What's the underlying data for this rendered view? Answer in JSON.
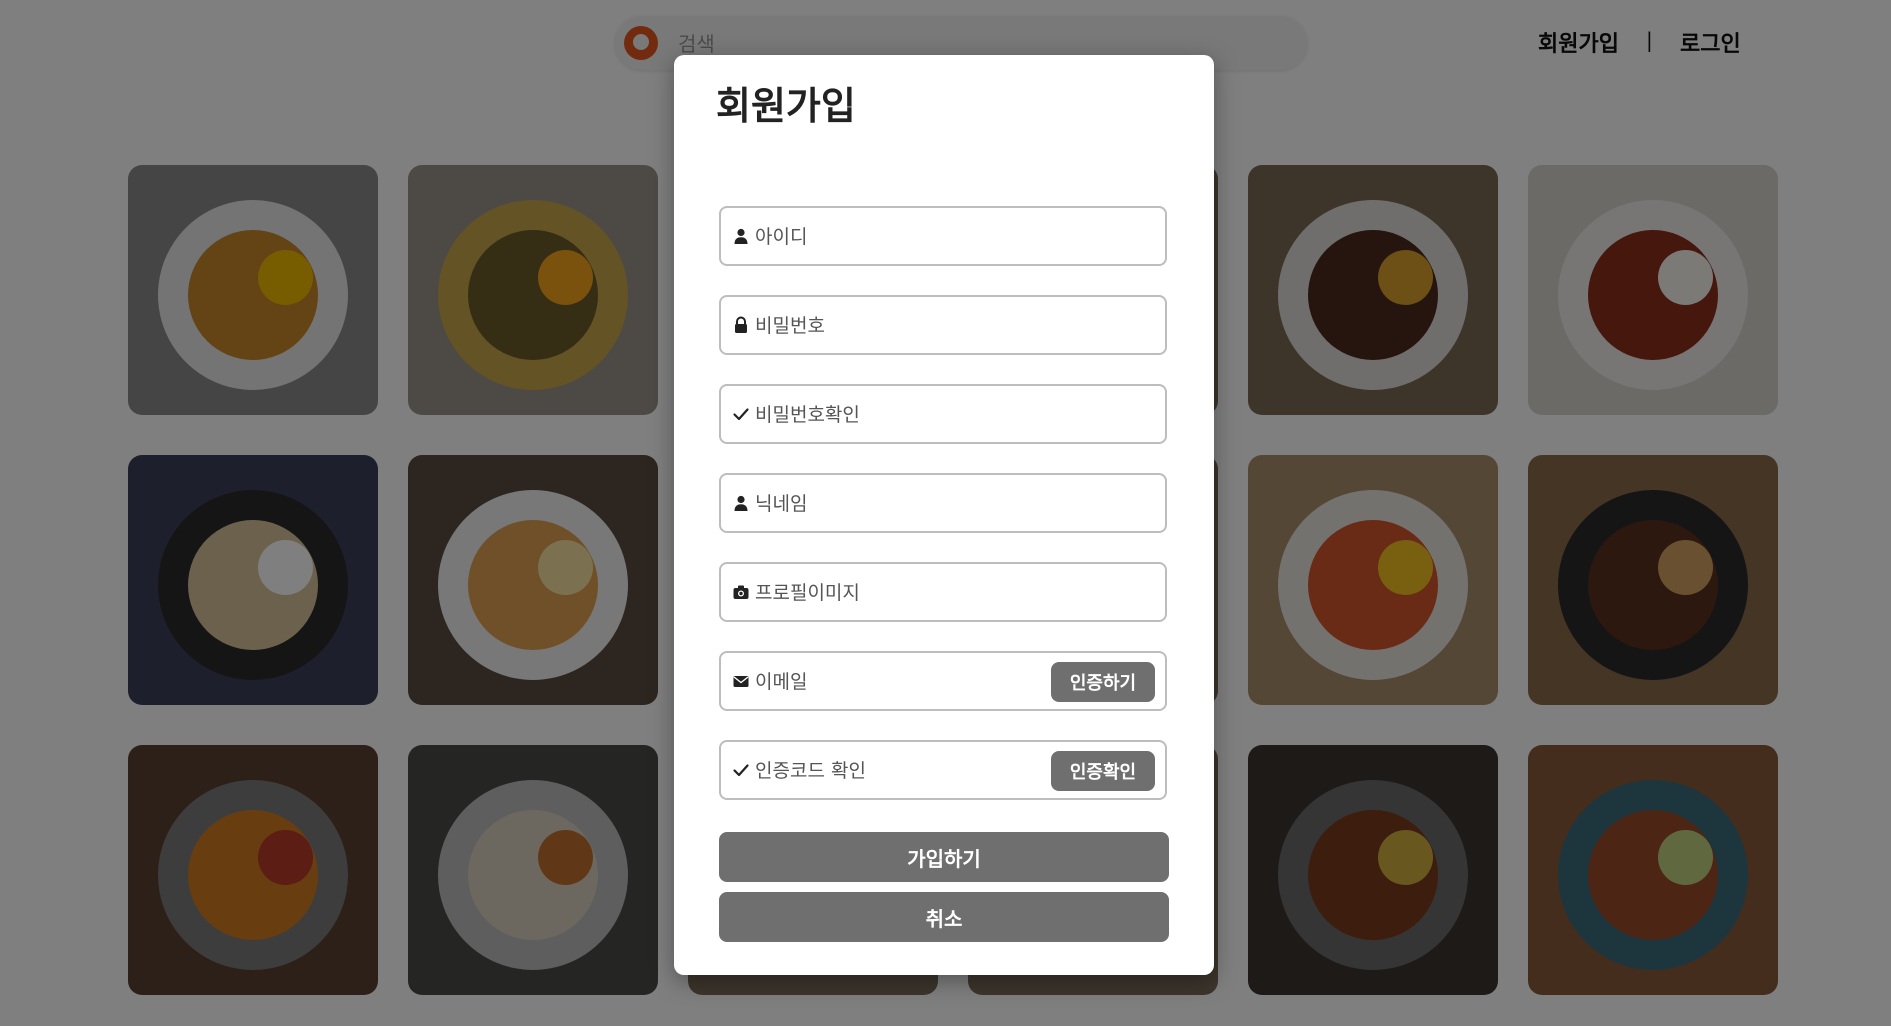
{
  "header": {
    "search_placeholder": "검색",
    "signup_link": "회원가입",
    "separator": "|",
    "login_link": "로그인"
  },
  "gallery": {
    "tiles": [
      {
        "name": "ramen-with-fried-egg",
        "bg": "#8a8a8a",
        "plate": "#e8e8e8",
        "food": "#c8862a",
        "accent": "#f0b800"
      },
      {
        "name": "bibimbap-bowl",
        "bg": "#9a958c",
        "plate": "#c7a64b",
        "food": "#6c5a2a",
        "accent": "#f4a21a"
      },
      {
        "name": "center-tile-1",
        "bg": "#7a6a5a",
        "plate": "#b08060",
        "food": "#6a3a20",
        "accent": "#d09040"
      },
      {
        "name": "center-tile-2",
        "bg": "#7a6a5a",
        "plate": "#b08060",
        "food": "#6a3a20",
        "accent": "#d09040"
      },
      {
        "name": "grilled-steak",
        "bg": "#7d6a55",
        "plate": "#e0ddd8",
        "food": "#4a2a1c",
        "accent": "#d9a02a"
      },
      {
        "name": "ghost-meatballs",
        "bg": "#d8d4cf",
        "plate": "#efece8",
        "food": "#8a2f1a",
        "accent": "#f7f4ee"
      },
      {
        "name": "fishcake-skewers",
        "bg": "#3b4158",
        "plate": "#2b2b2b",
        "food": "#d9c39a",
        "accent": "#ffffff"
      },
      {
        "name": "souffle-pancakes",
        "bg": "#5a4a3f",
        "plate": "#f0f0f0",
        "food": "#e0a050",
        "accent": "#f6e2a0"
      },
      {
        "name": "center-tile-3",
        "bg": "#7a6a5a",
        "plate": "#b08060",
        "food": "#6a3a20",
        "accent": "#d09040"
      },
      {
        "name": "center-tile-4",
        "bg": "#7a6a5a",
        "plate": "#b08060",
        "food": "#6a3a20",
        "accent": "#d09040"
      },
      {
        "name": "tteokbokki-set",
        "bg": "#a88f6d",
        "plate": "#e8e4df",
        "food": "#d2562a",
        "accent": "#f0c020"
      },
      {
        "name": "steak-cubes-skillet",
        "bg": "#8a6a4a",
        "plate": "#2a2a2a",
        "food": "#5a3020",
        "accent": "#d0a060"
      },
      {
        "name": "spicy-noodle-pan",
        "bg": "#5a4030",
        "plate": "#7a7a7a",
        "food": "#d07a20",
        "accent": "#b83a2a"
      },
      {
        "name": "oden-pot",
        "bg": "#4a4a48",
        "plate": "#bcbcbc",
        "food": "#d8d0c0",
        "accent": "#c07030"
      },
      {
        "name": "center-tile-5",
        "bg": "#7a6a5a",
        "plate": "#b08060",
        "food": "#6a3a20",
        "accent": "#d09040"
      },
      {
        "name": "center-tile-6",
        "bg": "#7a6a5a",
        "plate": "#b08060",
        "food": "#6a3a20",
        "accent": "#d09040"
      },
      {
        "name": "grilled-chicken-rice-balls",
        "bg": "#3a3530",
        "plate": "#6a6a6a",
        "food": "#7a3a1a",
        "accent": "#d0b040"
      },
      {
        "name": "grilled-skewers-plate",
        "bg": "#8a5a3a",
        "plate": "#3a6a7a",
        "food": "#9a4a2a",
        "accent": "#c0d080"
      }
    ]
  },
  "modal": {
    "title": "회원가입",
    "fields": {
      "id_placeholder": "아이디",
      "password_placeholder": "비밀번호",
      "password_confirm_placeholder": "비밀번호확인",
      "nickname_placeholder": "닉네임",
      "profile_image_placeholder": "프로필이미지",
      "email_placeholder": "이메일",
      "verify_code_placeholder": "인증코드 확인"
    },
    "buttons": {
      "send_verification": "인증하기",
      "confirm_verification": "인증확인",
      "submit": "가입하기",
      "cancel": "취소"
    }
  },
  "colors": {
    "brand": "#e4571c",
    "button": "#6f6f6f",
    "overlay": "rgba(0,0,0,0.5)"
  }
}
